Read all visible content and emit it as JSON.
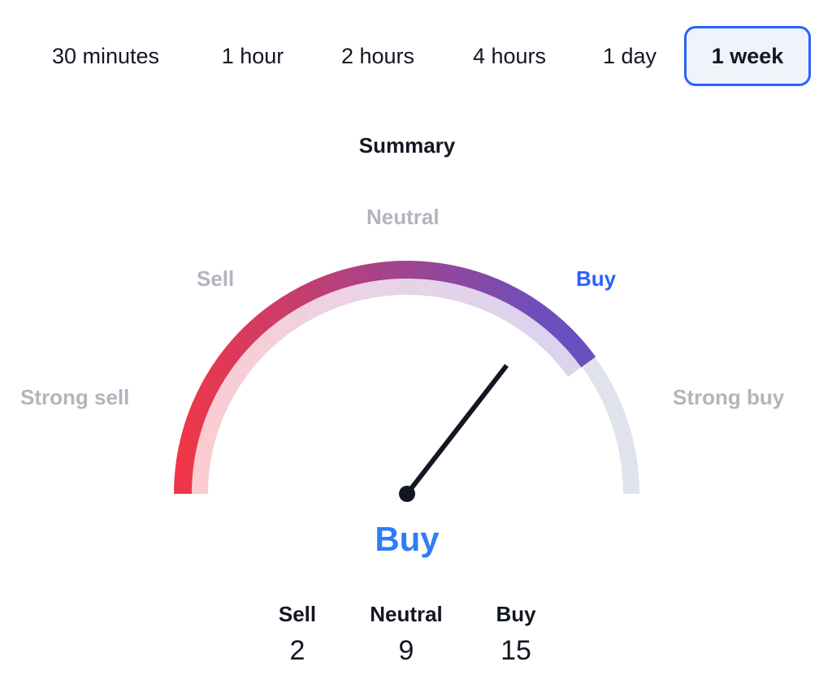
{
  "timeframes": {
    "items": [
      {
        "label": "30 minutes",
        "active": false
      },
      {
        "label": "1 hour",
        "active": false
      },
      {
        "label": "2 hours",
        "active": false
      },
      {
        "label": "4 hours",
        "active": false
      },
      {
        "label": "1 day",
        "active": false
      },
      {
        "label": "1 week",
        "active": true
      }
    ]
  },
  "summary": {
    "title": "Summary",
    "gauge_labels": {
      "strong_sell": "Strong sell",
      "sell": "Sell",
      "neutral": "Neutral",
      "buy": "Buy",
      "strong_buy": "Strong buy"
    },
    "active_zone": "buy",
    "needle_fraction": 0.71,
    "verdict": "Buy",
    "counts": [
      {
        "label": "Sell",
        "value": "2"
      },
      {
        "label": "Neutral",
        "value": "9"
      },
      {
        "label": "Buy",
        "value": "15"
      }
    ]
  },
  "colors": {
    "accent": "#2962ff",
    "verdict": "#2f7df6",
    "sell_red": "#f23645",
    "buy_purple": "#6a4fbf",
    "track_grey": "#e0e3eb",
    "label_grey": "#b2b5be",
    "text": "#131722"
  }
}
